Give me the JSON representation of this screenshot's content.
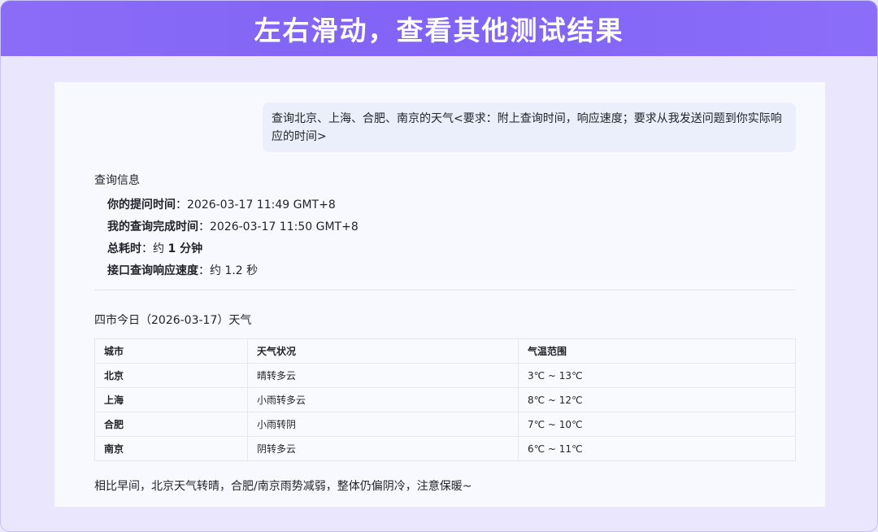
{
  "banner": {
    "title": "左右滑动，查看其他测试结果"
  },
  "chat": {
    "user_message": "查询北京、上海、合肥、南京的天气<要求：附上查询时间，响应速度；要求从我发送问题到你实际响应的时间>"
  },
  "query_info": {
    "heading": "查询信息",
    "rows": [
      {
        "label": "你的提问时间",
        "sep": "：",
        "value": "2026-03-17 11:49 GMT+8"
      },
      {
        "label": "我的查询完成时间",
        "sep": "：",
        "value": "2026-03-17 11:50 GMT+8"
      },
      {
        "label": "总耗时",
        "sep": "：",
        "prefix": "约 ",
        "value_bold": "1 分钟"
      },
      {
        "label": "接口查询响应速度",
        "sep": "：",
        "value": "约 1.2 秒"
      }
    ]
  },
  "weather": {
    "heading": "四市今日（2026-03-17）天气",
    "columns": [
      "城市",
      "天气状况",
      "气温范围"
    ],
    "rows": [
      {
        "city": "北京",
        "condition": "晴转多云",
        "temp": "3℃ ~ 13℃"
      },
      {
        "city": "上海",
        "condition": "小雨转多云",
        "temp": "8℃ ~ 12℃"
      },
      {
        "city": "合肥",
        "condition": "小雨转阴",
        "temp": "7℃ ~ 10℃"
      },
      {
        "city": "南京",
        "condition": "阴转多云",
        "temp": "6℃ ~ 11℃"
      }
    ]
  },
  "summary": "相比早间，北京天气转晴，合肥/南京雨势减弱，整体仍偏阴冷，注意保暖~",
  "colors": {
    "banner": "#8163f6",
    "background": "#e9e6fd",
    "bubble": "#ebeefb"
  }
}
